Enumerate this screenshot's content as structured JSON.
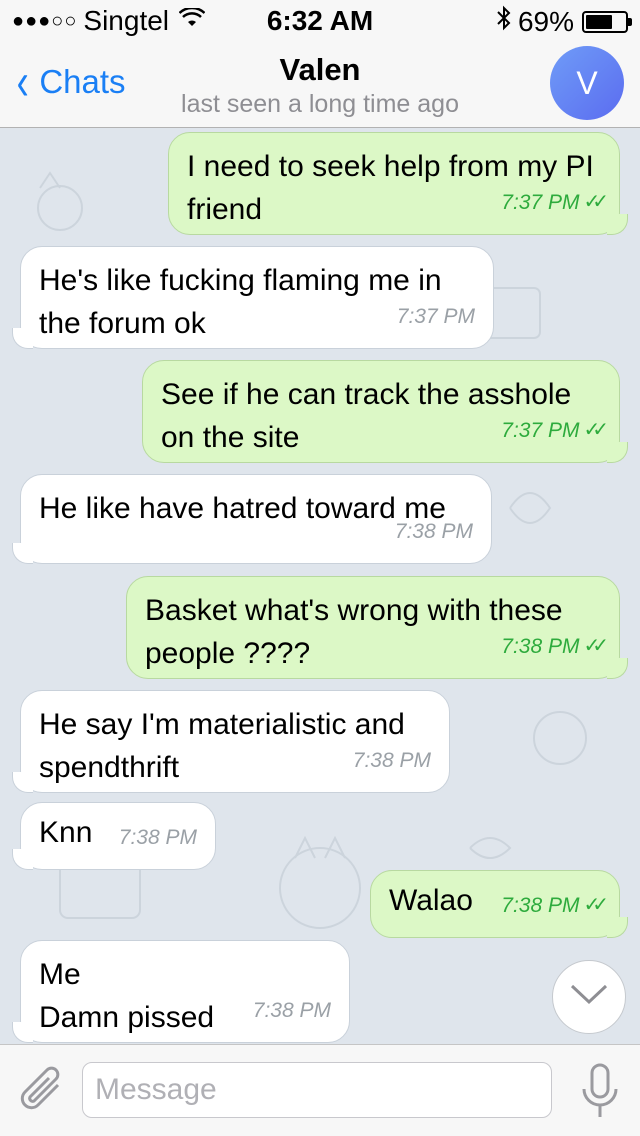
{
  "status_bar": {
    "signal": "●●●○○",
    "carrier": "Singtel",
    "time": "6:32 AM",
    "battery": "69%",
    "battery_level": 0.69
  },
  "nav": {
    "back_label": "Chats",
    "title": "Valen",
    "subtitle": "last seen a long time ago",
    "avatar_initial": "V"
  },
  "messages": [
    {
      "dir": "out",
      "text": "I need to seek help from my PI\nfriend",
      "time": "7:37 PM",
      "read": true
    },
    {
      "dir": "in",
      "text": "He's like fucking flaming me in\nthe forum ok",
      "time": "7:37 PM"
    },
    {
      "dir": "out",
      "text": "See if he can track the asshole\non the site",
      "time": "7:37 PM",
      "read": true
    },
    {
      "dir": "in",
      "text": "He like have hatred toward me",
      "time": "7:38 PM"
    },
    {
      "dir": "out",
      "text": "Basket what's wrong with these\npeople ????",
      "time": "7:38 PM",
      "read": true
    },
    {
      "dir": "in",
      "text": "He say I'm materialistic and\nspendthrift",
      "time": "7:38 PM"
    },
    {
      "dir": "in",
      "text": "Knn",
      "time": "7:38 PM"
    },
    {
      "dir": "out",
      "text": "Walao",
      "time": "7:38 PM",
      "read": true
    },
    {
      "dir": "in",
      "text": "Me\nDamn pissed",
      "time": "7:38 PM"
    }
  ],
  "input": {
    "placeholder": "Message"
  },
  "colors": {
    "accent": "#1a7ff5",
    "outgoing_bubble": "#dcf8c6",
    "incoming_bubble": "#ffffff",
    "read_ticks": "#2eab3d"
  },
  "icons": {
    "attach": "paperclip-icon",
    "mic": "microphone-icon",
    "scroll": "chevron-down-icon",
    "back": "chevron-left-icon"
  }
}
